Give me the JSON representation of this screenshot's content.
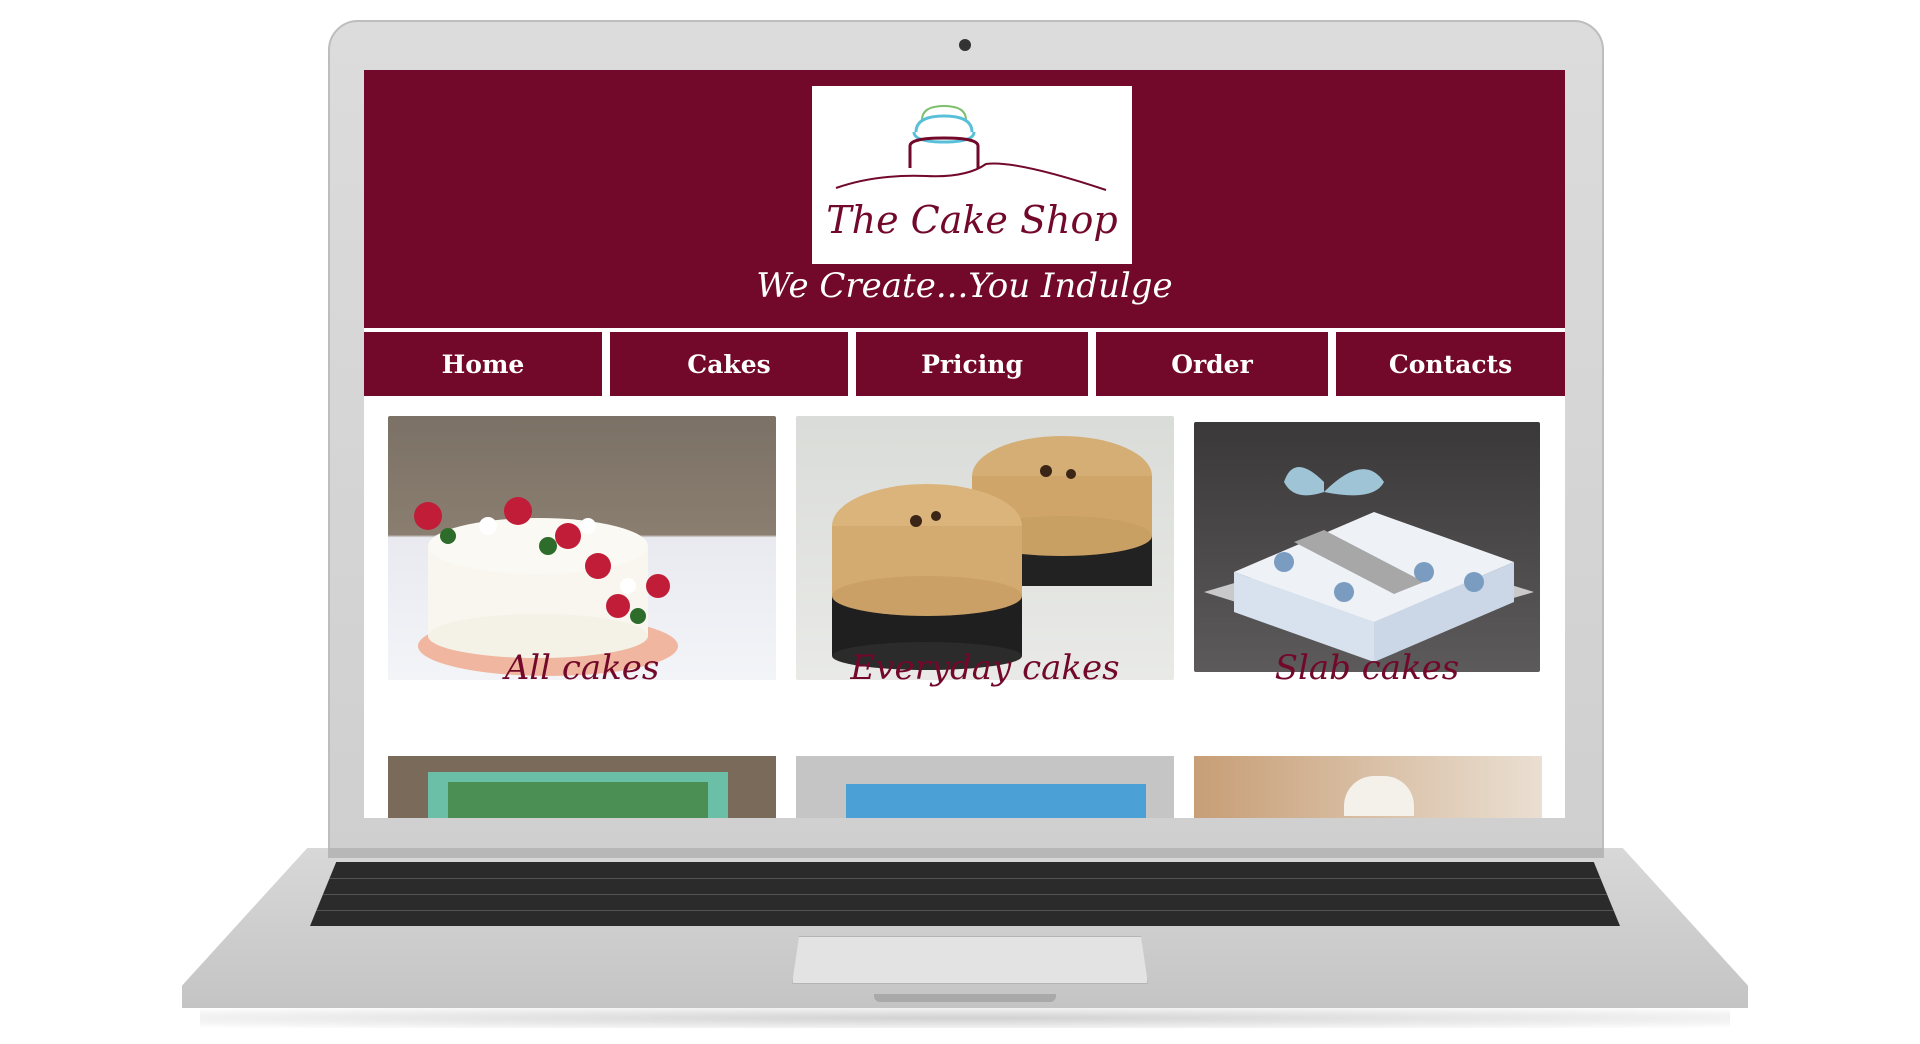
{
  "site": {
    "logo_text": "The Cake Shop",
    "tagline": "We Create...You Indulge"
  },
  "nav": {
    "items": [
      {
        "label": "Home"
      },
      {
        "label": "Cakes"
      },
      {
        "label": "Pricing"
      },
      {
        "label": "Order"
      },
      {
        "label": "Contacts"
      }
    ]
  },
  "gallery": {
    "cards": [
      {
        "caption": "All cakes",
        "image": "cake-with-flowers-image"
      },
      {
        "caption": "Everyday cakes",
        "image": "mocha-cakes-image"
      },
      {
        "caption": "Slab cakes",
        "image": "gift-box-cake-image"
      }
    ],
    "row2": [
      {
        "image": "sheet-cake-green-image"
      },
      {
        "image": "sheet-cake-blue-image"
      },
      {
        "image": "dessert-cups-image"
      }
    ]
  },
  "colors": {
    "brand": "#72082a",
    "header_bg": "#72082a",
    "laptop_body": "#d4d4d4",
    "keyboard": "#2b2b2b"
  }
}
